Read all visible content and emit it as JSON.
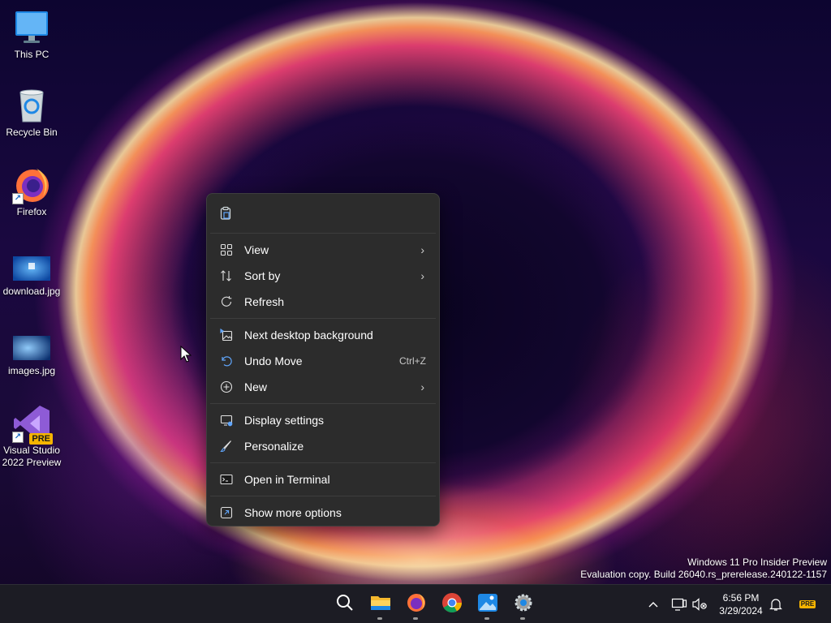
{
  "desktop": {
    "icons": [
      {
        "label": "This PC"
      },
      {
        "label": "Recycle Bin"
      },
      {
        "label": "Firefox"
      },
      {
        "label": "download.jpg"
      },
      {
        "label": "images.jpg"
      },
      {
        "label": "Visual Studio 2022 Preview",
        "badge": "PRE"
      }
    ]
  },
  "context_menu": {
    "top_icons": [
      "paste-icon"
    ],
    "items": [
      {
        "label": "View",
        "icon": "grid-icon",
        "submenu": true
      },
      {
        "label": "Sort by",
        "icon": "sort-icon",
        "submenu": true
      },
      {
        "label": "Refresh",
        "icon": "refresh-icon"
      },
      {
        "label": "Next desktop background",
        "icon": "next-background-icon"
      },
      {
        "label": "Undo Move",
        "icon": "undo-icon",
        "shortcut": "Ctrl+Z"
      },
      {
        "label": "New",
        "icon": "new-icon",
        "submenu": true
      },
      {
        "label": "Display settings",
        "icon": "display-settings-icon"
      },
      {
        "label": "Personalize",
        "icon": "personalize-icon"
      },
      {
        "label": "Open in Terminal",
        "icon": "terminal-icon"
      },
      {
        "label": "Show more options",
        "icon": "show-more-options-icon"
      }
    ]
  },
  "watermark": {
    "line1": "Windows 11 Pro Insider Preview",
    "line2": "Evaluation copy. Build 26040.rs_prerelease.240122-1157"
  },
  "taskbar": {
    "apps": [
      "search-icon",
      "file-explorer-icon",
      "firefox-icon",
      "chrome-icon",
      "photos-icon",
      "settings-icon"
    ],
    "clock": {
      "time": "6:56 PM",
      "date": "3/29/2024"
    },
    "tray_badge": "PRE"
  }
}
